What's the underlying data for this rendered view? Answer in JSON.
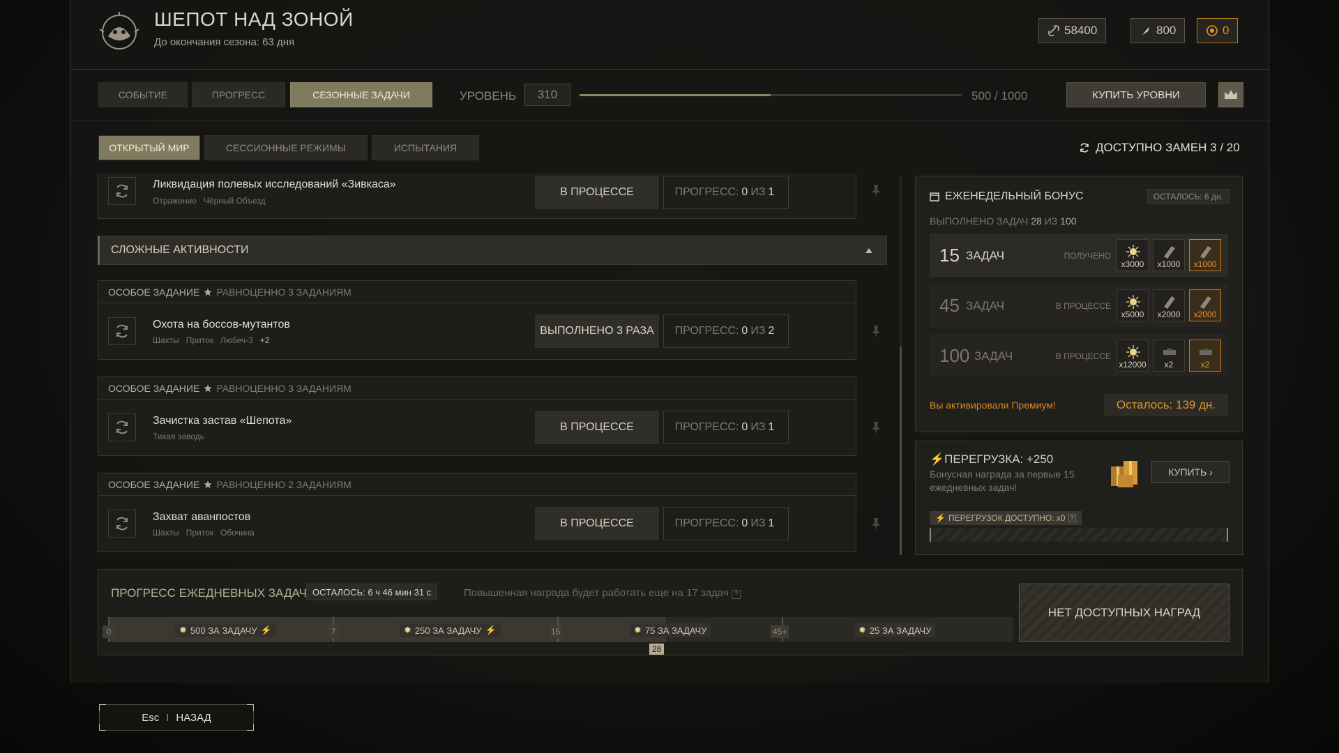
{
  "header": {
    "title": "ШЕПОТ НАД ЗОНОЙ",
    "subtitle": "До окончания сезона: 63 дня",
    "currencies": [
      {
        "icon": "chain-icon",
        "value": "58400"
      },
      {
        "icon": "feather-icon",
        "value": "800"
      },
      {
        "icon": "coin-icon",
        "value": "0"
      }
    ]
  },
  "nav": {
    "tabs": [
      "СОБЫТИЕ",
      "ПРОГРЕСС",
      "СЕЗОННЫЕ ЗАДАЧИ"
    ],
    "active_tab": "СЕЗОННЫЕ ЗАДАЧИ",
    "level_label": "УРОВЕНЬ",
    "level": "310",
    "level_progress_text": "500 / 1000",
    "level_progress_fraction": 0.5,
    "buy_levels": "КУПИТЬ УРОВНИ"
  },
  "subtabs": [
    "ОТКРЫТЫЙ МИР",
    "СЕССИОННЫЕ РЕЖИМЫ",
    "ИСПЫТАНИЯ"
  ],
  "swaps_text": "ДОСТУПНО ЗАМЕН 3 / 20",
  "tasks": {
    "first": {
      "name": "Ликвидация полевых исследований «Зивкаса»",
      "tags": [
        "Отражение",
        "Чёрный Объезд"
      ],
      "status": "В ПРОЦЕССЕ",
      "progress_label": "ПРОГРЕСС:",
      "progress_value": "0",
      "progress_of": "ИЗ",
      "progress_total": "1"
    },
    "section_title": "СЛОЖНЫЕ АКТИВНОСТИ",
    "special": [
      {
        "head": "ОСОБОЕ ЗАДАНИЕ",
        "equiv": "РАВНОЦЕННО 3 ЗАДАНИЯМ",
        "name": "Охота на боссов-мутантов",
        "tags": [
          "Шахты",
          "Приток",
          "Любеч-3"
        ],
        "more": "+2",
        "status": "ВЫПОЛНЕНО 3 РАЗА",
        "progress_label": "ПРОГРЕСС:",
        "progress_value": "0",
        "progress_of": "ИЗ",
        "progress_total": "2"
      },
      {
        "head": "ОСОБОЕ ЗАДАНИЕ",
        "equiv": "РАВНОЦЕННО 3 ЗАДАНИЯМ",
        "name": "Зачистка застав «Шепота»",
        "tags": [
          "Тихая заводь"
        ],
        "more": "",
        "status": "В ПРОЦЕССЕ",
        "progress_label": "ПРОГРЕСС:",
        "progress_value": "0",
        "progress_of": "ИЗ",
        "progress_total": "1"
      },
      {
        "head": "ОСОБОЕ ЗАДАНИЕ",
        "equiv": "РАВНОЦЕННО 2 ЗАДАНИЯМ",
        "name": "Захват аванпостов",
        "tags": [
          "Шахты",
          "Приток",
          "Обочина"
        ],
        "more": "",
        "status": "В ПРОЦЕССЕ",
        "progress_label": "ПРОГРЕСС:",
        "progress_value": "0",
        "progress_of": "ИЗ",
        "progress_total": "1"
      }
    ]
  },
  "weekly": {
    "title": "ЕЖЕНЕДЕЛЬНЫЙ БОНУС",
    "left": "ОСТАЛОСЬ: 6 дн.",
    "done_label": "ВЫПОЛНЕНО ЗАДАЧ",
    "done_value": "28",
    "done_of": "ИЗ",
    "done_total": "100",
    "tiers": [
      {
        "num": "15",
        "word": "ЗАДАЧ",
        "status": "ПОЛУЧЕНО",
        "rewards": [
          {
            "icon": "sun-icon",
            "qty": "x3000"
          },
          {
            "icon": "plate-icon",
            "qty": "x1000"
          },
          {
            "icon": "plate-icon",
            "qty": "x1000",
            "premium": true
          }
        ]
      },
      {
        "num": "45",
        "word": "ЗАДАЧ",
        "status": "В ПРОЦЕССЕ",
        "rewards": [
          {
            "icon": "sun-icon",
            "qty": "x5000"
          },
          {
            "icon": "plate-icon",
            "qty": "x2000"
          },
          {
            "icon": "plate-icon",
            "qty": "x2000",
            "premium": true
          }
        ]
      },
      {
        "num": "100",
        "word": "ЗАДАЧ",
        "status": "В ПРОЦЕССЕ",
        "rewards": [
          {
            "icon": "sun-icon",
            "qty": "x12000"
          },
          {
            "icon": "case-icon",
            "qty": "x2"
          },
          {
            "icon": "case-icon",
            "qty": "x2",
            "premium": true
          }
        ]
      }
    ],
    "premium_text": "Вы активировали Премиум!",
    "premium_left": "Осталось: 139 дн."
  },
  "overload": {
    "title": "ПЕРЕГРУЗКА: +250",
    "desc": "Бонусная награда за первые 15 ежедневных задач!",
    "buy": "КУПИТЬ",
    "available": "ПЕРЕГРУЗОК ДОСТУПНО: x0",
    "fill_fraction": 0
  },
  "daily": {
    "title": "ПРОГРЕСС ЕЖЕДНЕВНЫХ ЗАДАЧ",
    "left": "ОСТАЛОСЬ: 6 ч 46 мин 31 с",
    "note": "Повышенная награда будет работать еще на 17 задач",
    "milestones": [
      "0",
      "7",
      "15",
      "45+"
    ],
    "segments": [
      "500 ЗА ЗАДАЧУ",
      "250 ЗА ЗАДАЧУ",
      "75 ЗА ЗАДАЧУ",
      "25 ЗА ЗАДАЧУ"
    ],
    "current": "28",
    "no_rewards": "НЕТ ДОСТУПНЫХ НАГРАД"
  },
  "footer": {
    "key": "Esc",
    "label": "НАЗАД"
  },
  "colors": {
    "accent": "#807a5e",
    "gold": "#e0932a",
    "text": "#c9c3b4"
  }
}
